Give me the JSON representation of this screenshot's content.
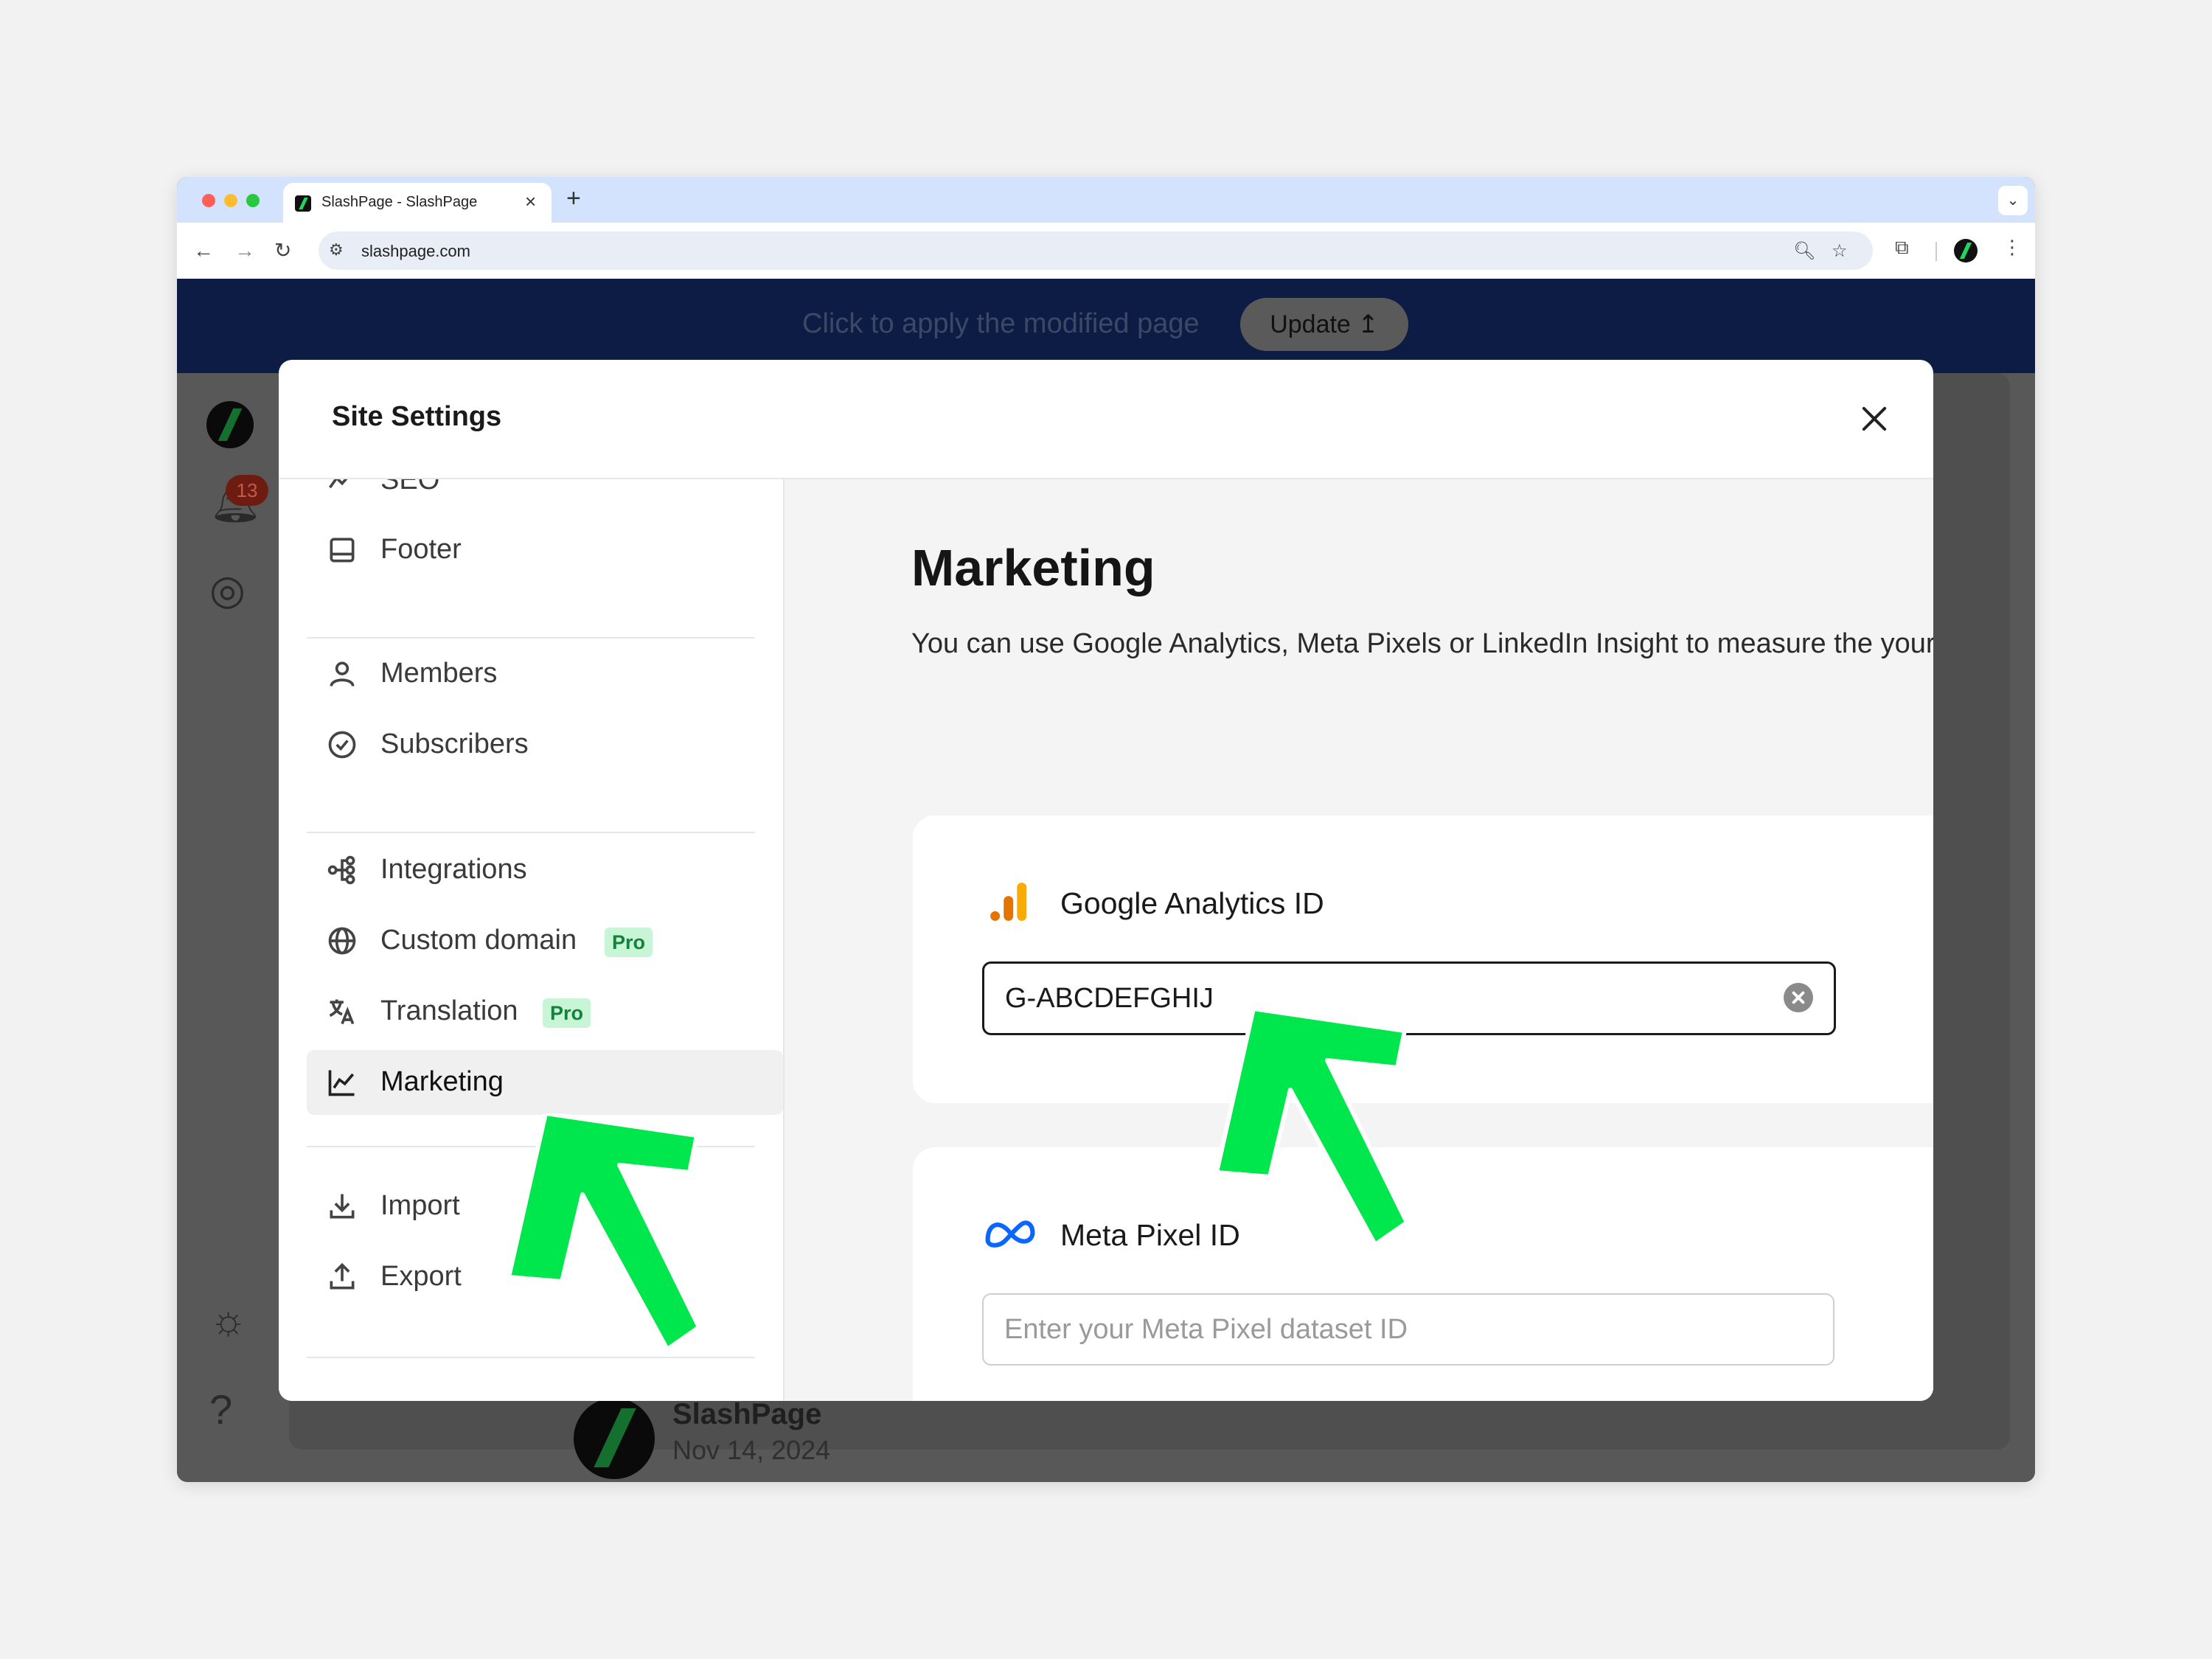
{
  "browser": {
    "tab_title": "SlashPage - SlashPage",
    "new_tab": "+",
    "tab_close": "×",
    "url": "slashpage.com",
    "colors": {
      "tabstrip": "#d3e3fd",
      "close_dot": "#ff5f57",
      "min_dot": "#febc2e",
      "max_dot": "#28c840"
    }
  },
  "update_bar": {
    "message": "Click to apply the modified page",
    "button_label": "Update ↥"
  },
  "app_background": {
    "notification_count": "13",
    "ghost_name": "SlashPage",
    "ghost_date": "Nov 14, 2024",
    "more": "..."
  },
  "modal": {
    "title": "Site Settings",
    "sidebar": {
      "items": [
        {
          "label": "SEO",
          "icon": "seo-icon"
        },
        {
          "label": "Footer",
          "icon": "footer-icon"
        },
        {
          "label": "Members",
          "icon": "user-icon"
        },
        {
          "label": "Subscribers",
          "icon": "check-circle-icon"
        },
        {
          "label": "Integrations",
          "icon": "integrations-icon"
        },
        {
          "label": "Custom domain",
          "icon": "globe-icon",
          "badge": "Pro"
        },
        {
          "label": "Translation",
          "icon": "translate-icon",
          "badge": "Pro"
        },
        {
          "label": "Marketing",
          "icon": "chart-line-icon",
          "active": true
        },
        {
          "label": "Import",
          "icon": "download-icon"
        },
        {
          "label": "Export",
          "icon": "upload-icon"
        }
      ]
    },
    "content": {
      "heading": "Marketing",
      "description": "You can use Google Analytics, Meta Pixels or LinkedIn Insight to measure the your page",
      "google_analytics": {
        "label": "Google Analytics ID",
        "value": "G-ABCDEFGHIJ"
      },
      "meta_pixel": {
        "label": "Meta Pixel ID",
        "placeholder": "Enter your Meta Pixel dataset ID"
      }
    }
  },
  "annotation_color": "#00e64d"
}
